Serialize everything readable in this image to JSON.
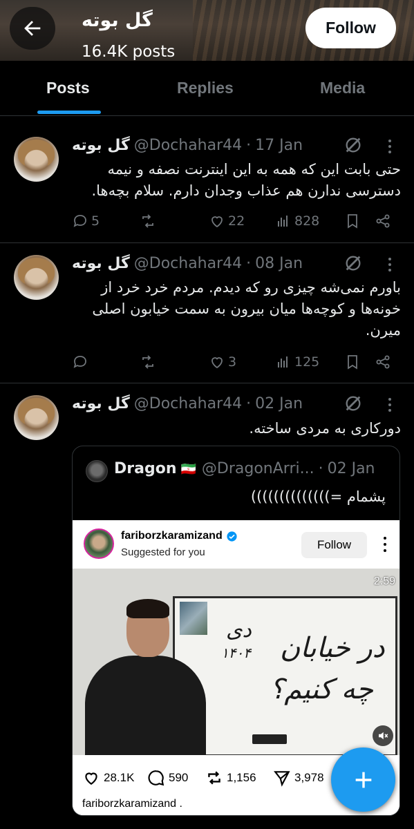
{
  "header": {
    "name": "گل بوته",
    "post_count": "16.4K posts",
    "follow_label": "Follow"
  },
  "tabs": [
    {
      "label": "Posts",
      "active": true
    },
    {
      "label": "Replies",
      "active": false
    },
    {
      "label": "Media",
      "active": false
    }
  ],
  "posts": [
    {
      "name": "گل بوته",
      "handle": "@Dochahar44",
      "date": "17 Jan",
      "text": "حتی بابت این که همه به این اینترنت نصفه و نیمه دسترسی ندارن هم عذاب وجدان دارم. سلام بچه‌ها.",
      "replies": "5",
      "reposts": "",
      "likes": "22",
      "views": "828"
    },
    {
      "name": "گل بوته",
      "handle": "@Dochahar44",
      "date": "08 Jan",
      "text": "باورم نمی‌شه چیزی رو که دیدم. مردم خرد خرد از خونه‌ها و کوچه‌ها میان بیرون به سمت خیابون اصلی میرن.",
      "replies": "",
      "reposts": "",
      "likes": "3",
      "views": "125"
    },
    {
      "name": "گل بوته",
      "handle": "@Dochahar44",
      "date": "02 Jan",
      "text": "دورکاری به مردی ساخته."
    }
  ],
  "quote": {
    "name": "Dragon",
    "flag": "🇮🇷",
    "handle": "@DragonArri...",
    "date": "02 Jan",
    "text": "پشمام =))))))))))))))",
    "embed": {
      "username": "fariborzkaramizand",
      "subtitle": "Suggested for you",
      "follow_label": "Follow",
      "video_time": "2:59",
      "board_text_1": "دی",
      "board_text_2": "۱۴۰۴",
      "board_text_3": "در خیابان",
      "board_text_4": "چه کنیم؟",
      "likes": "28.1K",
      "comments": "590",
      "reposts": "1,156",
      "shares": "3,978",
      "caption": "fariborzkaramizand ."
    }
  },
  "colors": {
    "accent": "#1d9bf0",
    "muted": "#71767b",
    "divider": "#2f3336"
  }
}
